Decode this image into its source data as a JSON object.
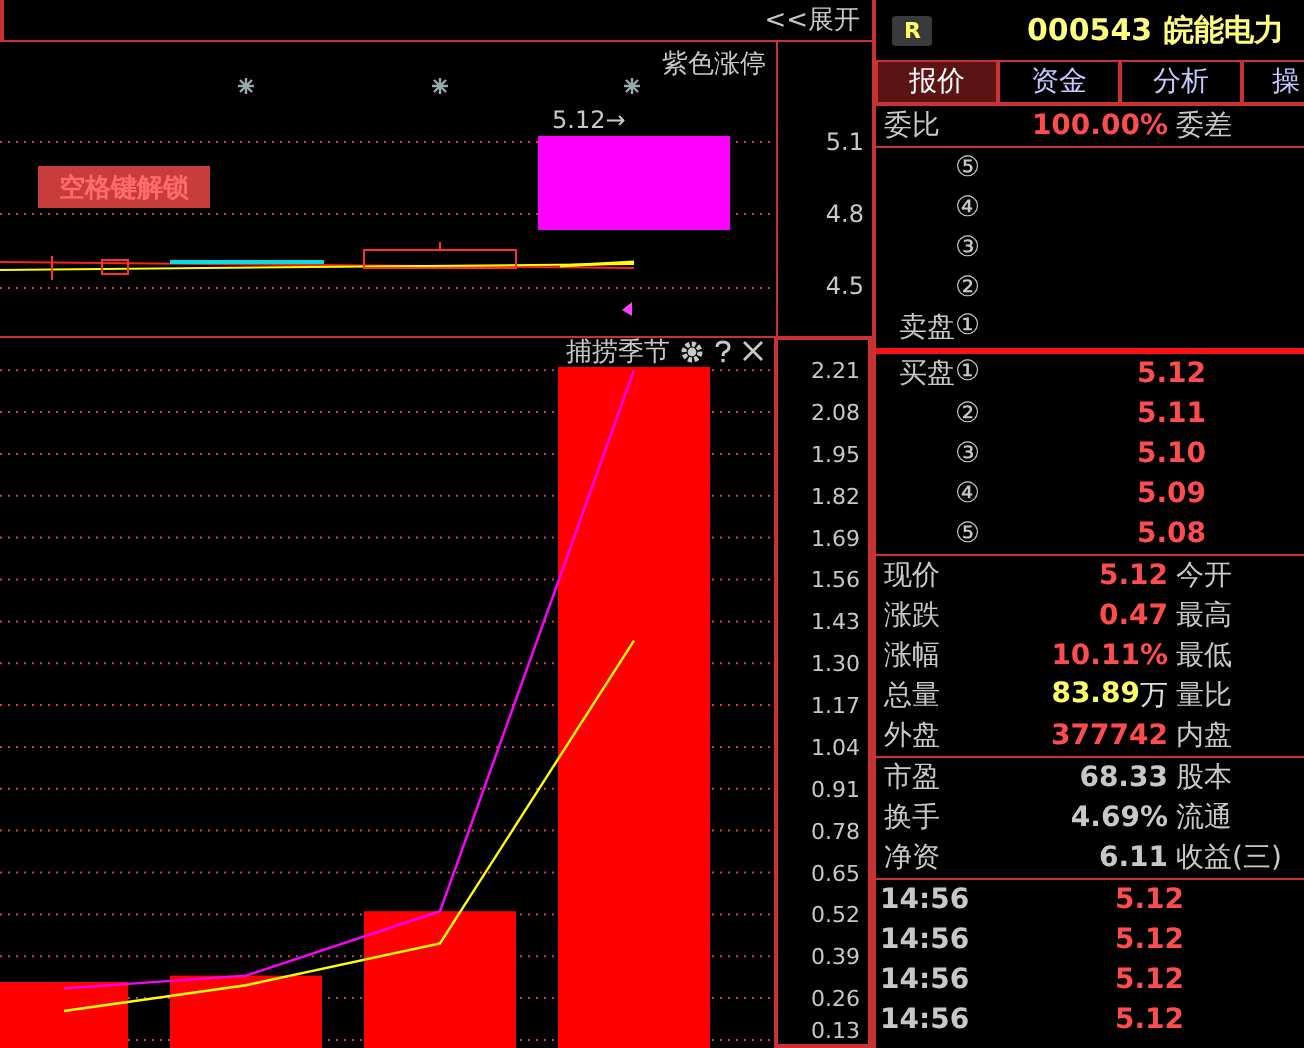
{
  "toolbar": {
    "expand_button": "<<展开"
  },
  "upper_chart": {
    "title": "紫色涨停",
    "price_tag": "5.12→",
    "unlock_button": "空格键解锁",
    "axis_labels": [
      "5.1",
      "4.8",
      "4.5"
    ]
  },
  "lower_chart": {
    "title": "捕捞季节",
    "chart_data": {
      "type": "bar",
      "grid": true,
      "ylim": [
        0.105,
        2.31
      ],
      "series": [
        {
          "color": "#ff0000",
          "values": [
            0.31,
            0.33,
            0.53,
            2.22
          ]
        },
        {
          "type": "line",
          "color": "#ff00ff",
          "values": [
            0.29,
            0.33,
            0.53,
            2.21
          ]
        },
        {
          "type": "line",
          "color": "#ffff00",
          "values": [
            0.22,
            0.3,
            0.43,
            1.37
          ]
        }
      ],
      "yticks": [
        {
          "value": 2.21,
          "label": "2.21"
        },
        {
          "value": 2.08,
          "label": "2.08"
        },
        {
          "value": 1.95,
          "label": "1.95"
        },
        {
          "value": 1.82,
          "label": "1.82"
        },
        {
          "value": 1.69,
          "label": "1.69"
        },
        {
          "value": 1.56,
          "label": "1.56"
        },
        {
          "value": 1.43,
          "label": "1.43"
        },
        {
          "value": 1.3,
          "label": "1.30"
        },
        {
          "value": 1.17,
          "label": "1.17"
        },
        {
          "value": 1.04,
          "label": "1.04"
        },
        {
          "value": 0.91,
          "label": "0.91"
        },
        {
          "value": 0.78,
          "label": "0.78"
        },
        {
          "value": 0.65,
          "label": "0.65"
        },
        {
          "value": 0.52,
          "label": "0.52"
        },
        {
          "value": 0.39,
          "label": "0.39"
        },
        {
          "value": 0.26,
          "label": "0.26"
        },
        {
          "value": 0.13,
          "label": "0.13"
        }
      ]
    }
  },
  "quote": {
    "badge": "R",
    "code": "000543",
    "name": "皖能电力",
    "tabs": [
      {
        "label": "报价",
        "selected": true
      },
      {
        "label": "资金",
        "selected": false
      },
      {
        "label": "分析",
        "selected": false
      },
      {
        "label": "操",
        "selected": false
      }
    ],
    "order_ratio": {
      "label": "委比",
      "value": "100.00%",
      "label2": "委差"
    },
    "sell": [
      {
        "index": "⑤"
      },
      {
        "index": "④"
      },
      {
        "index": "③"
      },
      {
        "index": "②"
      },
      {
        "prefix": "卖盘",
        "index": "①"
      }
    ],
    "buy": [
      {
        "prefix": "买盘",
        "index": "①",
        "price": "5.12"
      },
      {
        "index": "②",
        "price": "5.11"
      },
      {
        "index": "③",
        "price": "5.10"
      },
      {
        "index": "④",
        "price": "5.09"
      },
      {
        "index": "⑤",
        "price": "5.08"
      }
    ],
    "market": [
      {
        "label": "现价",
        "value": "5.12",
        "color": "#ff4d4d",
        "label2": "今开"
      },
      {
        "label": "涨跌",
        "value": "0.47",
        "color": "#ff4d4d",
        "label2": "最高"
      },
      {
        "label": "涨幅",
        "value": "10.11%",
        "color": "#ff4d4d",
        "label2": "最低"
      },
      {
        "label": "总量",
        "value": "83.89",
        "unit": "万",
        "color": "#ffff66",
        "label2": "量比"
      },
      {
        "label": "外盘",
        "value": "377742",
        "color": "#ff4d4d",
        "label2": "内盘"
      }
    ],
    "fundamentals": [
      {
        "label": "市盈",
        "value": "68.33",
        "label2": "股本"
      },
      {
        "label": "换手",
        "value": "4.69%",
        "label2": "流通"
      },
      {
        "label": "净资",
        "value": "6.11",
        "label2": "收益(三)"
      }
    ],
    "ticks": [
      {
        "time": "14:56",
        "price": "5.12"
      },
      {
        "time": "14:56",
        "price": "5.12"
      },
      {
        "time": "14:56",
        "price": "5.12"
      },
      {
        "time": "14:56",
        "price": "5.12"
      }
    ]
  }
}
